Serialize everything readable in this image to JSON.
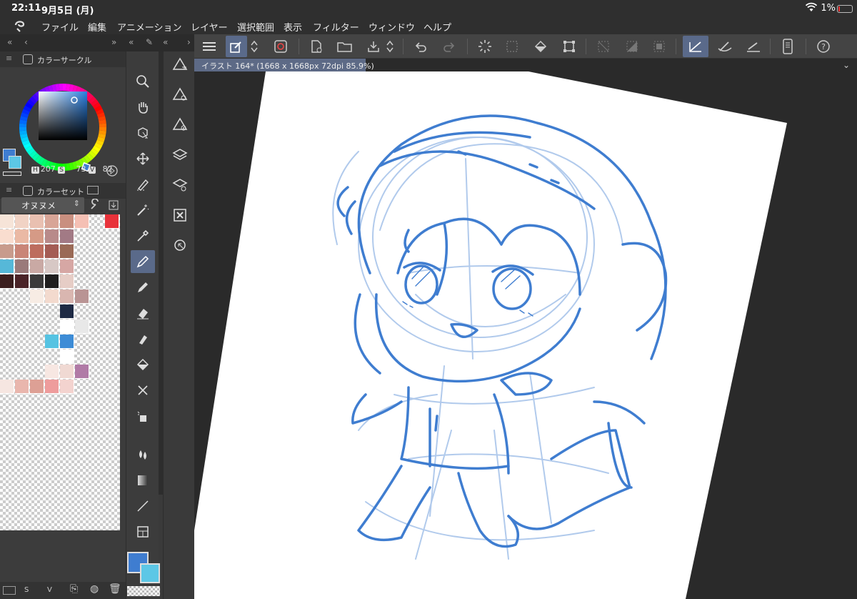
{
  "status": {
    "time": "22:11",
    "date": "9月5日 (月)",
    "battery": "1%"
  },
  "menu": [
    "ファイル",
    "編集",
    "アニメーション",
    "レイヤー",
    "選択範囲",
    "表示",
    "フィルター",
    "ウィンドウ",
    "ヘルプ"
  ],
  "color_circle": {
    "title": "カラーサークル",
    "h_label": "H",
    "h": "207",
    "s_label": "S",
    "s": "73",
    "v_label": "V",
    "v": "82"
  },
  "color_set": {
    "title": "カラーセット",
    "selected": "オヌヌメ",
    "swatches": [
      [
        "#f6e4d8",
        "#f1d3c5",
        "#e9c0b1",
        "#d8a597",
        "#c98f7f",
        "#f5c0b4",
        null,
        "#e8323a"
      ],
      [
        "#f9ddcf",
        "#eab9a4",
        "#d59a86",
        "#b88a8a",
        "#a27a85",
        null,
        null,
        null
      ],
      [
        "#c89b8c",
        "#c98577",
        "#bd6d5e",
        "#a45c54",
        "#9a6a56",
        null,
        null,
        null
      ],
      [
        "#56b8d8",
        "#9a7a7a",
        "#c9a9a4",
        "#d7c8c5",
        "#d6a7a4",
        null,
        null,
        null
      ],
      [
        "#3a1d1d",
        "#4a2327",
        "#3a3a3a",
        "#1e1e1e",
        "#e6cdc6",
        null,
        null,
        null
      ],
      [
        null,
        null,
        "#f7ece4",
        "#f3dace",
        "#d9b6b0",
        "#b99494",
        null,
        null
      ],
      [
        null,
        null,
        null,
        null,
        "#1e2a44",
        null,
        null,
        null
      ],
      [
        null,
        null,
        null,
        null,
        "#ffffff",
        "#e8e8e8",
        null,
        null
      ],
      [
        null,
        null,
        null,
        "#56c3e2",
        "#3d8cd6",
        null,
        null,
        null
      ],
      [
        null,
        null,
        null,
        null,
        "#ffffff",
        null,
        null,
        null
      ],
      [
        null,
        null,
        null,
        "#f7e7e2",
        "#f0d9d3",
        "#b07aa6",
        null,
        null
      ],
      [
        "#f6e6e1",
        "#e9b6ad",
        "#dda095",
        "#ee9c9c",
        "#f3d3cf",
        null,
        null,
        null
      ]
    ]
  },
  "colors": {
    "main": "#3f7dd0",
    "sub": "#5cc7e6"
  },
  "document": {
    "tab_label": "イラスト 164* (1668 x 1668px 72dpi 85.9%)"
  }
}
